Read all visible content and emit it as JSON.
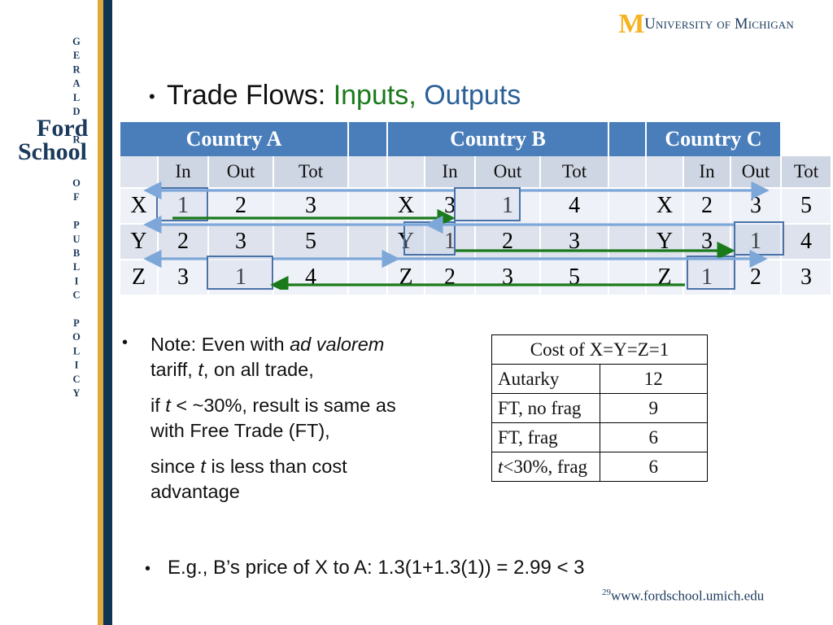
{
  "branding": {
    "gerald": "GERALD R.",
    "ford": "Ford",
    "school": "School",
    "policy": "OF PUBLIC POLICY",
    "navy": "#1b3a5c",
    "gold": "#e0a93b"
  },
  "logo": {
    "m": "M",
    "text": "University of Michigan",
    "maize": "#f5b324",
    "navy": "#1b3a5c"
  },
  "title": {
    "bullet": "•",
    "main": "Trade Flows: ",
    "inputs": "Inputs",
    "comma": ", ",
    "outputs": "Outputs",
    "inputs_color": "#1a7a1a",
    "outputs_color": "#2a6099"
  },
  "trade_table": {
    "header_color": "#4a7ebb",
    "countries": [
      "Country A",
      "Country B",
      "Country C"
    ],
    "sub_headers": [
      "In",
      "Out",
      "Tot"
    ],
    "row_labels": [
      "X",
      "Y",
      "Z"
    ],
    "blocks": [
      {
        "country": "Country A",
        "rows": [
          {
            "label": "X",
            "in": "1",
            "out": "2",
            "tot": "3"
          },
          {
            "label": "Y",
            "in": "2",
            "out": "3",
            "tot": "5"
          },
          {
            "label": "Z",
            "in": "3",
            "out": "1",
            "tot": "4"
          }
        ]
      },
      {
        "country": "Country B",
        "rows": [
          {
            "label": "X",
            "in": "3",
            "out": "1",
            "tot": "4"
          },
          {
            "label": "Y",
            "in": "1",
            "out": "2",
            "tot": "3"
          },
          {
            "label": "Z",
            "in": "2",
            "out": "3",
            "tot": "5"
          }
        ]
      },
      {
        "country": "Country C",
        "rows": [
          {
            "label": "X",
            "in": "2",
            "out": "3",
            "tot": "5"
          },
          {
            "label": "Y",
            "in": "3",
            "out": "1",
            "tot": "4"
          },
          {
            "label": "Z",
            "in": "1",
            "out": "2",
            "tot": "3"
          }
        ]
      }
    ],
    "highlights": [
      {
        "country": "Country A",
        "row": "X",
        "col": "In",
        "value": "1"
      },
      {
        "country": "Country A",
        "row": "Z",
        "col": "Out",
        "value": "1"
      },
      {
        "country": "Country B",
        "row": "X",
        "col": "Out",
        "value": "1"
      },
      {
        "country": "Country B",
        "row": "Y",
        "col": "In",
        "value": "1"
      },
      {
        "country": "Country C",
        "row": "Y",
        "col": "Out",
        "value": "1"
      },
      {
        "country": "Country C",
        "row": "Z",
        "col": "In",
        "value": "1"
      }
    ],
    "arrow_colors": {
      "output": "#7da7d9",
      "input": "#1a7a1a"
    }
  },
  "notes": {
    "bullet": "•",
    "line1_a": "Note:  Even with ",
    "line1_italic": "ad valorem",
    "line2_a": "tariff, ",
    "line2_italic": "t",
    "line2_b": ", on all trade,",
    "line3_a": "if ",
    "line3_italic": "t",
    "line3_b": " < ~30%, result is same as",
    "line4": "with Free Trade (FT),",
    "line5_a": "since ",
    "line5_italic": "t",
    "line5_b": " is less than cost",
    "line6": "advantage"
  },
  "cost_table": {
    "header": "Cost of X=Y=Z=1",
    "rows": [
      {
        "label": "Autarky",
        "label_italic": "",
        "value": "12"
      },
      {
        "label": "FT, no frag",
        "label_italic": "",
        "value": "9"
      },
      {
        "label": "FT, frag",
        "label_italic": "",
        "value": "6"
      },
      {
        "label": "<30%, frag",
        "label_italic": "t",
        "value": "6"
      }
    ]
  },
  "example": {
    "bullet": "•",
    "text": "E.g., B’s price of X to A:  1.3(1+1.3(1)) = 2.99 < 3"
  },
  "footer": {
    "page": "29",
    "url": "www.fordschool.umich.edu"
  }
}
